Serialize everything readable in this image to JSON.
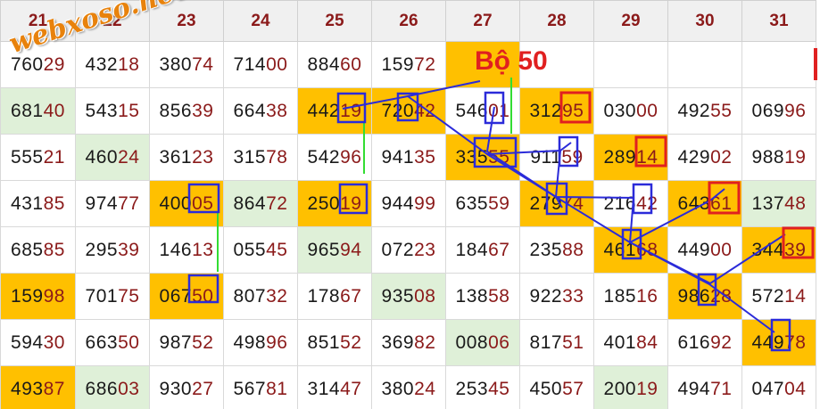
{
  "headers": [
    "21",
    "22",
    "23",
    "24",
    "25",
    "26",
    "27",
    "28",
    "29",
    "30",
    "31"
  ],
  "rows": [
    [
      {
        "v": "76029",
        "hl": false,
        "gr": false
      },
      {
        "v": "43218",
        "hl": false,
        "gr": false
      },
      {
        "v": "38074",
        "hl": false,
        "gr": false
      },
      {
        "v": "71400",
        "hl": false,
        "gr": false
      },
      {
        "v": "88460",
        "hl": false,
        "gr": false
      },
      {
        "v": "15972",
        "hl": false,
        "gr": false
      },
      {
        "v": "",
        "hl": true,
        "gr": false
      },
      {
        "v": "",
        "hl": false,
        "gr": false
      },
      {
        "v": "",
        "hl": false,
        "gr": false
      },
      {
        "v": "",
        "hl": false,
        "gr": false
      },
      {
        "v": "",
        "hl": false,
        "gr": false
      }
    ],
    [
      {
        "v": "68140",
        "hl": false,
        "gr": true
      },
      {
        "v": "54315",
        "hl": false,
        "gr": false
      },
      {
        "v": "85639",
        "hl": false,
        "gr": false
      },
      {
        "v": "66438",
        "hl": false,
        "gr": false
      },
      {
        "v": "44219",
        "hl": true,
        "gr": false
      },
      {
        "v": "72042",
        "hl": true,
        "gr": false
      },
      {
        "v": "54601",
        "hl": false,
        "gr": false
      },
      {
        "v": "31295",
        "hl": true,
        "gr": false
      },
      {
        "v": "03000",
        "hl": false,
        "gr": false
      },
      {
        "v": "49255",
        "hl": false,
        "gr": false
      },
      {
        "v": "06996",
        "hl": false,
        "gr": false
      }
    ],
    [
      {
        "v": "55521",
        "hl": false,
        "gr": false
      },
      {
        "v": "46024",
        "hl": false,
        "gr": true
      },
      {
        "v": "36123",
        "hl": false,
        "gr": false
      },
      {
        "v": "31578",
        "hl": false,
        "gr": false
      },
      {
        "v": "54296",
        "hl": false,
        "gr": false
      },
      {
        "v": "94135",
        "hl": false,
        "gr": false
      },
      {
        "v": "33555",
        "hl": true,
        "gr": false
      },
      {
        "v": "91159",
        "hl": false,
        "gr": false
      },
      {
        "v": "28914",
        "hl": true,
        "gr": false
      },
      {
        "v": "42902",
        "hl": false,
        "gr": false
      },
      {
        "v": "98819",
        "hl": false,
        "gr": false
      }
    ],
    [
      {
        "v": "43185",
        "hl": false,
        "gr": false
      },
      {
        "v": "97477",
        "hl": false,
        "gr": false
      },
      {
        "v": "40005",
        "hl": true,
        "gr": false
      },
      {
        "v": "86472",
        "hl": false,
        "gr": true
      },
      {
        "v": "25019",
        "hl": true,
        "gr": false
      },
      {
        "v": "94499",
        "hl": false,
        "gr": false
      },
      {
        "v": "63559",
        "hl": false,
        "gr": false
      },
      {
        "v": "27974",
        "hl": true,
        "gr": false
      },
      {
        "v": "21642",
        "hl": false,
        "gr": false
      },
      {
        "v": "64361",
        "hl": true,
        "gr": false
      },
      {
        "v": "13748",
        "hl": false,
        "gr": true
      }
    ],
    [
      {
        "v": "68585",
        "hl": false,
        "gr": false
      },
      {
        "v": "29539",
        "hl": false,
        "gr": false
      },
      {
        "v": "14613",
        "hl": false,
        "gr": false
      },
      {
        "v": "05545",
        "hl": false,
        "gr": false
      },
      {
        "v": "96594",
        "hl": false,
        "gr": true
      },
      {
        "v": "07223",
        "hl": false,
        "gr": false
      },
      {
        "v": "18467",
        "hl": false,
        "gr": false
      },
      {
        "v": "23588",
        "hl": false,
        "gr": false
      },
      {
        "v": "46168",
        "hl": true,
        "gr": false
      },
      {
        "v": "44900",
        "hl": false,
        "gr": false
      },
      {
        "v": "34439",
        "hl": true,
        "gr": false
      }
    ],
    [
      {
        "v": "15998",
        "hl": true,
        "gr": false
      },
      {
        "v": "70175",
        "hl": false,
        "gr": false
      },
      {
        "v": "06750",
        "hl": true,
        "gr": false
      },
      {
        "v": "80732",
        "hl": false,
        "gr": false
      },
      {
        "v": "17867",
        "hl": false,
        "gr": false
      },
      {
        "v": "93508",
        "hl": false,
        "gr": true
      },
      {
        "v": "13858",
        "hl": false,
        "gr": false
      },
      {
        "v": "92233",
        "hl": false,
        "gr": false
      },
      {
        "v": "18516",
        "hl": false,
        "gr": false
      },
      {
        "v": "98628",
        "hl": true,
        "gr": false
      },
      {
        "v": "57214",
        "hl": false,
        "gr": false
      }
    ],
    [
      {
        "v": "59430",
        "hl": false,
        "gr": false
      },
      {
        "v": "66350",
        "hl": false,
        "gr": false
      },
      {
        "v": "98752",
        "hl": false,
        "gr": false
      },
      {
        "v": "49896",
        "hl": false,
        "gr": false
      },
      {
        "v": "85152",
        "hl": false,
        "gr": false
      },
      {
        "v": "36982",
        "hl": false,
        "gr": false
      },
      {
        "v": "00806",
        "hl": false,
        "gr": true
      },
      {
        "v": "81751",
        "hl": false,
        "gr": false
      },
      {
        "v": "40184",
        "hl": false,
        "gr": false
      },
      {
        "v": "61692",
        "hl": false,
        "gr": false
      },
      {
        "v": "44978",
        "hl": true,
        "gr": false
      }
    ],
    [
      {
        "v": "49387",
        "hl": true,
        "gr": false
      },
      {
        "v": "68603",
        "hl": false,
        "gr": true
      },
      {
        "v": "93027",
        "hl": false,
        "gr": false
      },
      {
        "v": "56781",
        "hl": false,
        "gr": false
      },
      {
        "v": "31447",
        "hl": false,
        "gr": false
      },
      {
        "v": "38024",
        "hl": false,
        "gr": false
      },
      {
        "v": "25345",
        "hl": false,
        "gr": false
      },
      {
        "v": "45057",
        "hl": false,
        "gr": false
      },
      {
        "v": "20019",
        "hl": false,
        "gr": true
      },
      {
        "v": "49471",
        "hl": false,
        "gr": false
      },
      {
        "v": "04704",
        "hl": false,
        "gr": false
      }
    ]
  ],
  "watermark": "webxoso.net",
  "annotation_label": "Bộ 50",
  "colors": {
    "highlight": "#ffc000",
    "green_cell": "#dff0d8",
    "marker_blue": "#2b2bd9",
    "marker_red": "#e02020",
    "line_green": "#33dd33",
    "text_dark": "#1a1a1a",
    "text_red": "#8b1a1a"
  }
}
